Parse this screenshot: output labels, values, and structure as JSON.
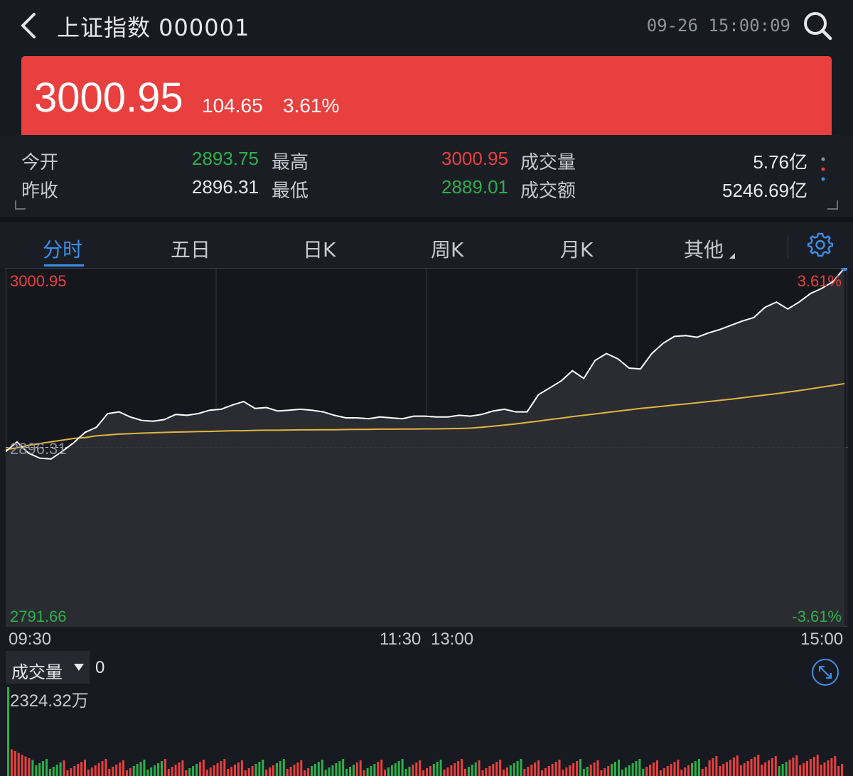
{
  "header": {
    "title": "上证指数 000001",
    "time": "09-26 15:00:09"
  },
  "quote": {
    "price": "3000.95",
    "change": "104.65",
    "change_pct": "3.61%"
  },
  "stats": {
    "open_label": "今开",
    "open": "2893.75",
    "prev_close_label": "昨收",
    "prev_close": "2896.31",
    "high_label": "最高",
    "high": "3000.95",
    "low_label": "最低",
    "low": "2889.01",
    "volume_label": "成交量",
    "volume": "5.76亿",
    "amount_label": "成交额",
    "amount": "5246.69亿"
  },
  "tabs": [
    "分时",
    "五日",
    "日K",
    "周K",
    "月K",
    "其他"
  ],
  "colors": {
    "up": "#e8403e",
    "down": "#2cb04a",
    "accent": "#3b8fe8",
    "avg_line": "#e0b640",
    "price_line": "#ffffff"
  },
  "chart_data": {
    "type": "line",
    "y_top_label": "3000.95",
    "y_bottom_label": "2791.66",
    "y_mid_label": "2896.31",
    "pct_top_label": "3.61%",
    "pct_bottom_label": "-3.61%",
    "ylim": [
      2791.66,
      3000.95
    ],
    "x_ticks": [
      "09:30",
      "11:30",
      "13:00",
      "15:00"
    ],
    "series": [
      {
        "values": [
          2893.8,
          2899.5,
          2893.0,
          2890.0,
          2889.5,
          2894.0,
          2899.0,
          2905.0,
          2908.0,
          2916.0,
          2917.0,
          2914.0,
          2912.0,
          2911.5,
          2912.5,
          2915.5,
          2915.0,
          2916.0,
          2918.0,
          2918.5,
          2921.0,
          2923.0,
          2919.0,
          2919.5,
          2917.5,
          2918.0,
          2918.5,
          2918.0,
          2917.0,
          2915.0,
          2913.5,
          2913.5,
          2913.0,
          2914.0,
          2913.5,
          2913.0,
          2914.5,
          2914.5,
          2914.0,
          2914.0,
          2915.0,
          2914.5,
          2915.5,
          2917.5,
          2918.5,
          2917.0,
          2917.0,
          2927.0,
          2931.0,
          2935.0,
          2941.0,
          2936.5,
          2947.0,
          2951.0,
          2948.0,
          2942.5,
          2942.0,
          2951.0,
          2957.0,
          2961.0,
          2961.5,
          2960.5,
          2963.0,
          2965.0,
          2967.5,
          2970.0,
          2972.0,
          2978.0,
          2981.0,
          2977.0,
          2981.0,
          2986.0,
          2989.0,
          2993.0,
          3000.95
        ]
      },
      {
        "values": [
          2895.0,
          2896.0,
          2897.5,
          2898.5,
          2899.5,
          2900.5,
          2901.5,
          2902.0,
          2903.0,
          2903.5,
          2904.0,
          2904.3,
          2904.6,
          2904.8,
          2905.0,
          2905.2,
          2905.3,
          2905.5,
          2905.6,
          2905.8,
          2906.0,
          2906.0,
          2906.2,
          2906.3,
          2906.3,
          2906.4,
          2906.5,
          2906.5,
          2906.6,
          2906.6,
          2906.7,
          2906.8,
          2906.8,
          2906.9,
          2906.9,
          2907.0,
          2907.0,
          2907.1,
          2907.1,
          2907.2,
          2907.3,
          2907.5,
          2908.0,
          2908.6,
          2909.3,
          2910.0,
          2910.8,
          2911.6,
          2912.5,
          2913.3,
          2914.2,
          2915.0,
          2915.8,
          2916.6,
          2917.4,
          2918.2,
          2919.0,
          2919.6,
          2920.3,
          2921.0,
          2921.6,
          2922.3,
          2923.0,
          2923.7,
          2924.4,
          2925.2,
          2926.0,
          2926.8,
          2927.6,
          2928.5,
          2929.4,
          2930.4,
          2931.4,
          2932.4,
          2933.5
        ]
      }
    ],
    "volume_label": "成交量",
    "volume_value": "0",
    "volume_max_label": "2324.32万"
  }
}
